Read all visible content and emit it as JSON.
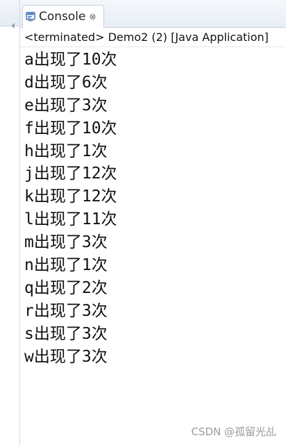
{
  "tab": {
    "icon": "console-icon",
    "title": "Console",
    "close_icon": "close-icon",
    "close_glyph": "⊗"
  },
  "status": "<terminated> Demo2 (2) [Java Application]",
  "output_lines": [
    "a出现了10次",
    "d出现了6次",
    "e出现了3次",
    "f出现了10次",
    "h出现了1次",
    "j出现了12次",
    "k出现了12次",
    "l出现了11次",
    "m出现了3次",
    "n出现了1次",
    "q出现了2次",
    "r出现了3次",
    "s出现了3次",
    "w出现了3次"
  ],
  "watermark": "CSDN @孤留光乩",
  "colors": {
    "tab_border": "#c8d0dc",
    "console_icon_blue": "#3a6fb5",
    "watermark": "#9a9a9a"
  }
}
